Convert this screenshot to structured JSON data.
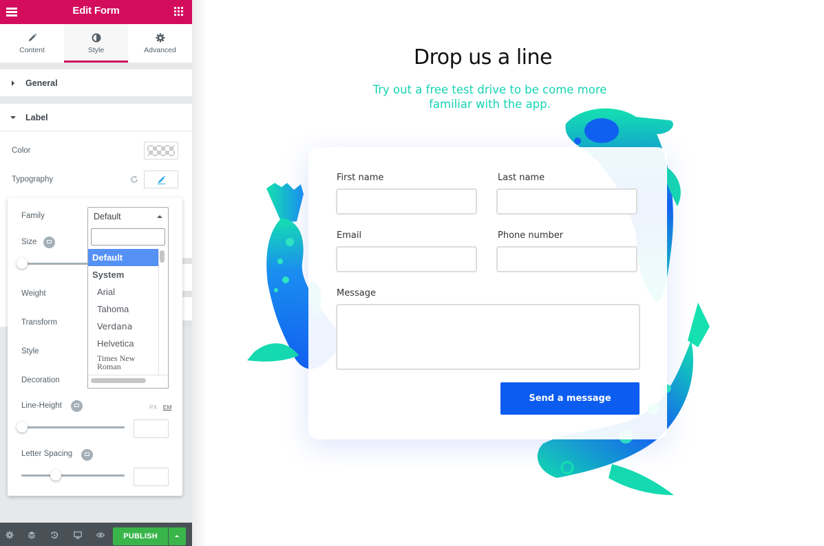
{
  "editor": {
    "header": {
      "title": "Edit Form",
      "menu_icon": "hamburger-icon",
      "apps_icon": "grid-icon"
    },
    "tabs": [
      {
        "label": "Content",
        "icon": "pencil-icon",
        "active": false
      },
      {
        "label": "Style",
        "icon": "half-circle-icon",
        "active": true
      },
      {
        "label": "Advanced",
        "icon": "gear-icon",
        "active": false
      }
    ],
    "sections": {
      "general": {
        "title": "General",
        "expanded": false
      },
      "label": {
        "title": "Label",
        "expanded": true
      }
    },
    "controls": {
      "color_label": "Color",
      "typography_label": "Typography"
    },
    "typography_popover": {
      "family_label": "Family",
      "family_value": "Default",
      "size_label": "Size",
      "weight_label": "Weight",
      "transform_label": "Transform",
      "style_label": "Style",
      "decoration_label": "Decoration",
      "line_height_label": "Line-Height",
      "letter_spacing_label": "Letter Spacing",
      "units": [
        "PX",
        "EM"
      ],
      "active_unit": "EM",
      "size_slider_value": 0,
      "line_height_slider_value": 0,
      "letter_spacing_slider_fraction": 0.33,
      "font_options": [
        {
          "label": "Default",
          "type": "selected"
        },
        {
          "label": "System",
          "type": "group"
        },
        {
          "label": "Arial",
          "type": "option"
        },
        {
          "label": "Tahoma",
          "type": "option"
        },
        {
          "label": "Verdana",
          "type": "option"
        },
        {
          "label": "Helvetica",
          "type": "option"
        },
        {
          "label": "Times New Roman",
          "type": "option"
        }
      ]
    },
    "footer": {
      "icons": [
        "gear-icon",
        "layers-icon",
        "history-icon",
        "desktop-icon",
        "eye-icon"
      ],
      "publish_label": "PUBLISH"
    },
    "colors": {
      "brand": "#d30c5c",
      "publish": "#39b54a",
      "footer_bg": "#495157",
      "dropdown_selected": "#5591f5"
    }
  },
  "page": {
    "heading": "Drop us a line",
    "subheading": "Try out a free test drive to be come more familiar with the app.",
    "form": {
      "fields": [
        {
          "label": "First name",
          "value": ""
        },
        {
          "label": "Last name",
          "value": ""
        },
        {
          "label": "Email",
          "value": ""
        },
        {
          "label": "Phone number",
          "value": ""
        },
        {
          "label": "Message",
          "value": ""
        }
      ],
      "submit_label": "Send a message"
    },
    "colors": {
      "subheading": "#15d3b4",
      "button": "#0c5cf0",
      "fish_blue": "#1060f0",
      "fish_green": "#15e0b0"
    }
  }
}
